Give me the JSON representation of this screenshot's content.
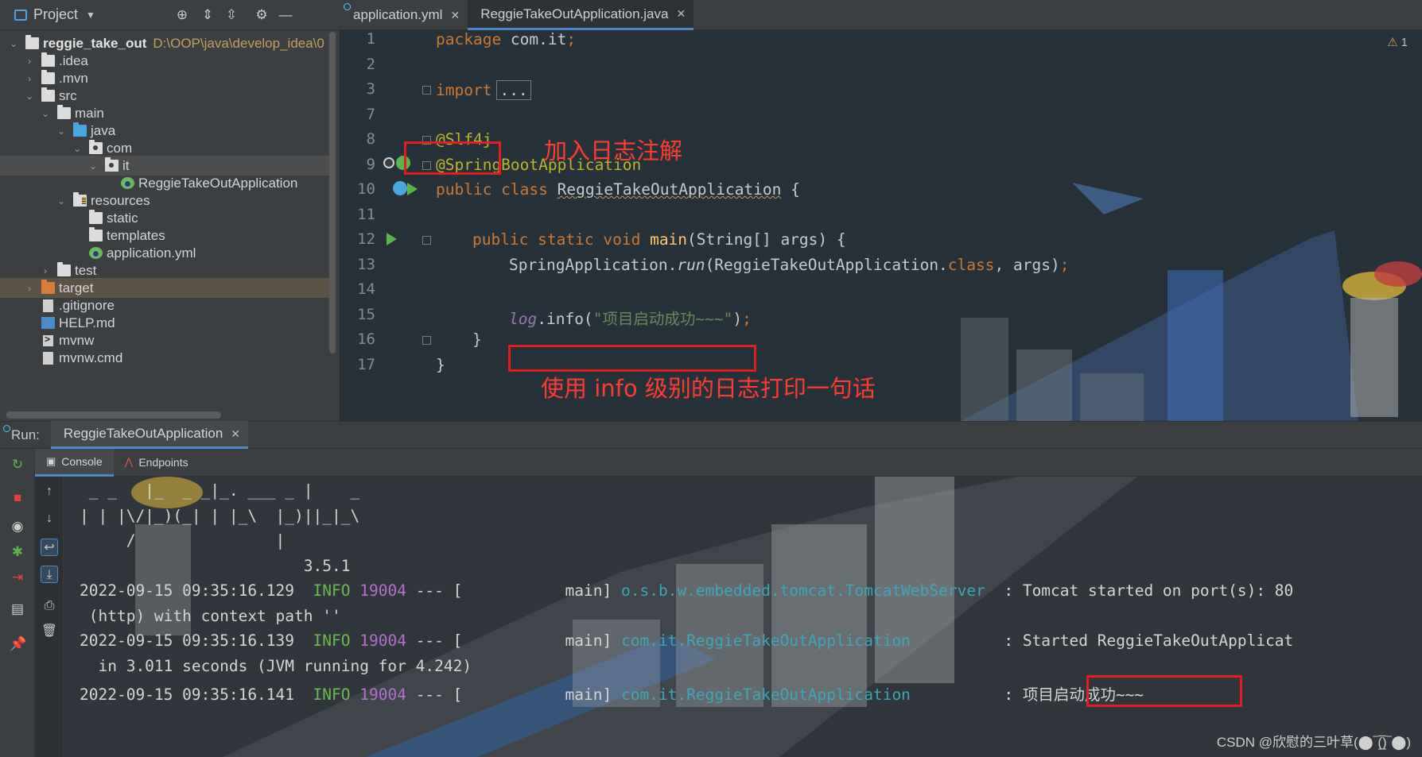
{
  "project": {
    "title": "Project",
    "tree": [
      {
        "label": "reggie_take_out",
        "path": "D:\\OOP\\java\\develop_idea\\0",
        "depth": 0,
        "arrow": "v",
        "icon": "folder",
        "bold": true
      },
      {
        "label": ".idea",
        "depth": 1,
        "arrow": ">",
        "icon": "folder"
      },
      {
        "label": ".mvn",
        "depth": 1,
        "arrow": ">",
        "icon": "folder"
      },
      {
        "label": "src",
        "depth": 1,
        "arrow": "v",
        "icon": "folder"
      },
      {
        "label": "main",
        "depth": 2,
        "arrow": "v",
        "icon": "folder"
      },
      {
        "label": "java",
        "depth": 3,
        "arrow": "v",
        "icon": "folder-blue"
      },
      {
        "label": "com",
        "depth": 4,
        "arrow": "v",
        "icon": "package"
      },
      {
        "label": "it",
        "depth": 5,
        "arrow": "v",
        "icon": "package",
        "selected": true
      },
      {
        "label": "ReggieTakeOutApplication",
        "depth": 6,
        "arrow": "",
        "icon": "spring-class"
      },
      {
        "label": "resources",
        "depth": 3,
        "arrow": "v",
        "icon": "folder-resources"
      },
      {
        "label": "static",
        "depth": 4,
        "arrow": "",
        "icon": "folder"
      },
      {
        "label": "templates",
        "depth": 4,
        "arrow": "",
        "icon": "folder"
      },
      {
        "label": "application.yml",
        "depth": 4,
        "arrow": "",
        "icon": "spring-yml"
      },
      {
        "label": "test",
        "depth": 2,
        "arrow": ">",
        "icon": "folder"
      },
      {
        "label": "target",
        "depth": 1,
        "arrow": ">",
        "icon": "folder-orange",
        "excluded": true
      },
      {
        "label": ".gitignore",
        "depth": 1,
        "arrow": "",
        "icon": "file"
      },
      {
        "label": "HELP.md",
        "depth": 1,
        "arrow": "",
        "icon": "markdown"
      },
      {
        "label": "mvnw",
        "depth": 1,
        "arrow": "",
        "icon": "terminal"
      },
      {
        "label": "mvnw.cmd",
        "depth": 1,
        "arrow": "",
        "icon": "file"
      }
    ]
  },
  "editor": {
    "tabs": [
      {
        "label": "application.yml",
        "active": false
      },
      {
        "label": "ReggieTakeOutApplication.java",
        "active": true
      }
    ],
    "warning_count": "1",
    "line_numbers": [
      "1",
      "2",
      "3",
      "7",
      "8",
      "9",
      "10",
      "11",
      "12",
      "13",
      "14",
      "15",
      "16",
      "17"
    ],
    "code": {
      "l1_kw": "package",
      "l1_rest": " com.it",
      "l1_semi": ";",
      "l3_kw": "import",
      "l3_dots": "...",
      "l8_ann": "@Slf4j",
      "l9_ann": "@SpringBootApplication",
      "l10_kw": "public class",
      "l10_name": "ReggieTakeOutApplication",
      "l10_brace": " {",
      "l12_kw": "public static void",
      "l12_fn": "main",
      "l12_rest": "(String[] args) {",
      "l13_cls": "SpringApplication.",
      "l13_fn": "run",
      "l13_mid": "(ReggieTakeOutApplication.",
      "l13_kw": "class",
      "l13_end": ", args)",
      "l13_semi": ";",
      "l15_log": "log",
      "l15_mid": ".info(",
      "l15_str": "\"项目启动成功~~~\"",
      "l15_end": ")",
      "l15_semi": ";",
      "l16": "}",
      "l17": "}"
    },
    "annotations": {
      "slf4j_note": "加入日志注解",
      "info_note": "使用 info 级别的日志打印一句话"
    }
  },
  "run": {
    "label": "Run:",
    "tab": "ReggieTakeOutApplication",
    "console_tabs": [
      "Console",
      "Endpoints"
    ],
    "banner": [
      " _ _   |_  _ _|_. ___ _ |    _",
      "| | |\\/|_)(_| | |_\\  |_)||_|_\\",
      "     /               |",
      "                        3.5.1"
    ],
    "logs": [
      {
        "ts": "2022-09-15 09:35:16.129",
        "level": "INFO",
        "pid": "19004",
        "sep": "--- [",
        "thread": "main]",
        "logger": "o.s.b.w.embedded.tomcat.TomcatWebServer",
        "msg": ": Tomcat started on port(s): 80",
        "cont": " (http) with context path ''"
      },
      {
        "ts": "2022-09-15 09:35:16.139",
        "level": "INFO",
        "pid": "19004",
        "sep": "--- [",
        "thread": "main]",
        "logger": "com.it.ReggieTakeOutApplication",
        "msg": ": Started ReggieTakeOutApplicat",
        "cont": "  in 3.011 seconds (JVM running for 4.242)"
      },
      {
        "ts": "2022-09-15 09:35:16.141",
        "level": "INFO",
        "pid": "19004",
        "sep": "--- [",
        "thread": "main]",
        "logger": "com.it.ReggieTakeOutApplication",
        "msg": ": 项目启动成功~~~",
        "cont": ""
      }
    ]
  },
  "watermark": "CSDN @欣慰的三叶草(⬤‾(̲̅)‾⬤)",
  "colors": {
    "accent": "#4a88c7",
    "annotation_red": "#e02020",
    "keyword": "#cc7832",
    "annotation_yellow": "#bbb529",
    "string_green": "#6a8759"
  }
}
